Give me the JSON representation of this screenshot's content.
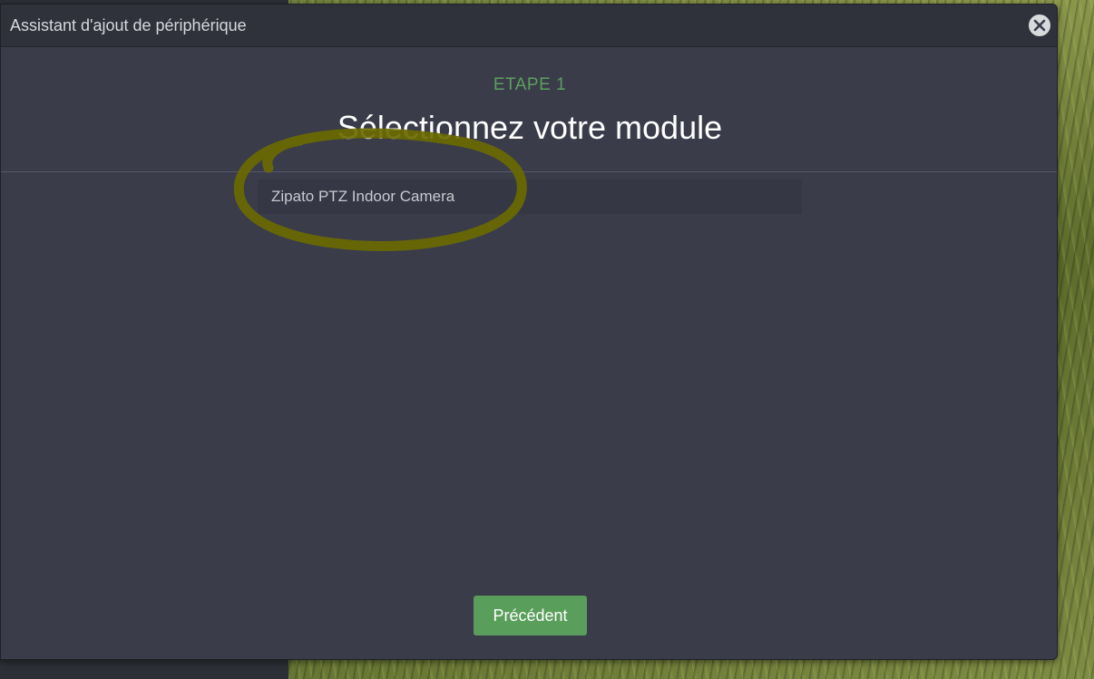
{
  "dialog": {
    "title": "Assistant d'ajout de périphérique",
    "close_icon": "close-circle-icon"
  },
  "wizard": {
    "step_label": "ETAPE 1",
    "heading": "Sélectionnez votre module",
    "modules": [
      {
        "label": "Zipato PTZ Indoor Camera"
      }
    ]
  },
  "footer": {
    "previous_label": "Précédent"
  },
  "colors": {
    "step_accent": "#5c9f5f",
    "button_green": "#5a9e5c",
    "modal_bg": "#3a3c4a",
    "annotation": "#6b6a00"
  }
}
